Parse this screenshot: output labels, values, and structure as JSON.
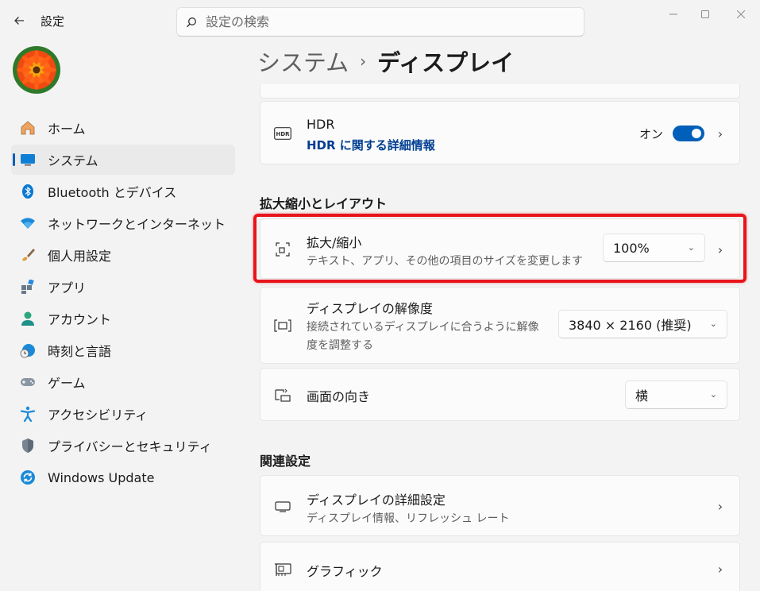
{
  "window": {
    "title": "設定"
  },
  "search": {
    "placeholder": "設定の検索"
  },
  "sidebar": {
    "items": [
      {
        "label": "ホーム",
        "icon": "home-icon"
      },
      {
        "label": "システム",
        "icon": "system-icon",
        "selected": true
      },
      {
        "label": "Bluetooth とデバイス",
        "icon": "bluetooth-icon"
      },
      {
        "label": "ネットワークとインターネット",
        "icon": "network-icon"
      },
      {
        "label": "個人用設定",
        "icon": "brush-icon"
      },
      {
        "label": "アプリ",
        "icon": "apps-icon"
      },
      {
        "label": "アカウント",
        "icon": "account-icon"
      },
      {
        "label": "時刻と言語",
        "icon": "time-language-icon"
      },
      {
        "label": "ゲーム",
        "icon": "gamepad-icon"
      },
      {
        "label": "アクセシビリティ",
        "icon": "accessibility-icon"
      },
      {
        "label": "プライバシーとセキュリティ",
        "icon": "shield-icon"
      },
      {
        "label": "Windows Update",
        "icon": "update-icon"
      }
    ]
  },
  "breadcrumb": {
    "parent": "システム",
    "current": "ディスプレイ"
  },
  "hdr": {
    "title": "HDR",
    "link": "HDR に関する詳細情報",
    "state_label": "オン",
    "enabled": true
  },
  "scale_layout": {
    "section_title": "拡大縮小とレイアウト",
    "scale": {
      "title": "拡大/縮小",
      "subtitle": "テキスト、アプリ、その他の項目のサイズを変更します",
      "value": "100%"
    },
    "resolution": {
      "title": "ディスプレイの解像度",
      "subtitle_line1": "接続されているディスプレイに合うように解像",
      "subtitle_line2": "度を調整する",
      "value": "3840 × 2160 (推奨)"
    },
    "orientation": {
      "title": "画面の向き",
      "value": "横"
    }
  },
  "related": {
    "section_title": "関連設定",
    "advanced_display": {
      "title": "ディスプレイの詳細設定",
      "subtitle": "ディスプレイ情報、リフレッシュ レート"
    },
    "graphics": {
      "title": "グラフィック"
    }
  },
  "colors": {
    "accent": "#005fb8",
    "highlight": "#e8141c"
  }
}
